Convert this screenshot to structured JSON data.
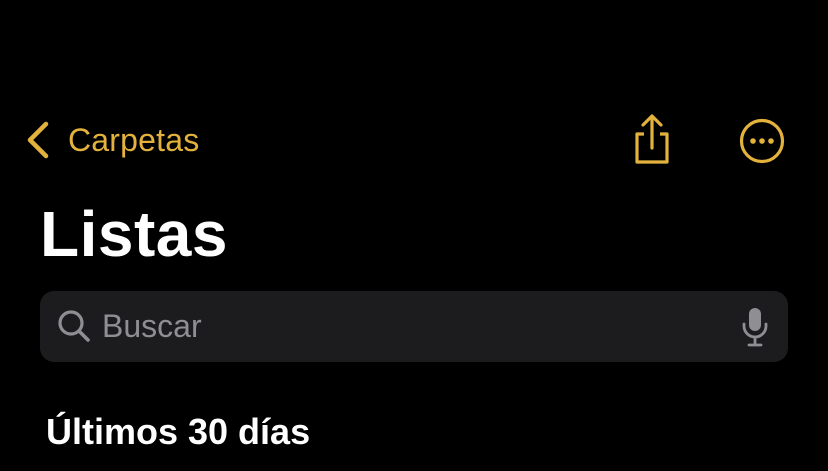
{
  "nav": {
    "back_label": "Carpetas",
    "back_icon": "chevron-left-icon",
    "share_icon": "share-icon",
    "more_icon": "ellipsis-circle-icon"
  },
  "title": "Listas",
  "search": {
    "placeholder": "Buscar",
    "value": "",
    "search_icon": "magnifier-icon",
    "mic_icon": "microphone-icon"
  },
  "section": {
    "header": "Últimos 30 días"
  },
  "colors": {
    "background": "#000000",
    "accent": "#e3b23c",
    "search_bg": "#1c1c1e",
    "placeholder": "#8e8e93",
    "text": "#ffffff"
  }
}
